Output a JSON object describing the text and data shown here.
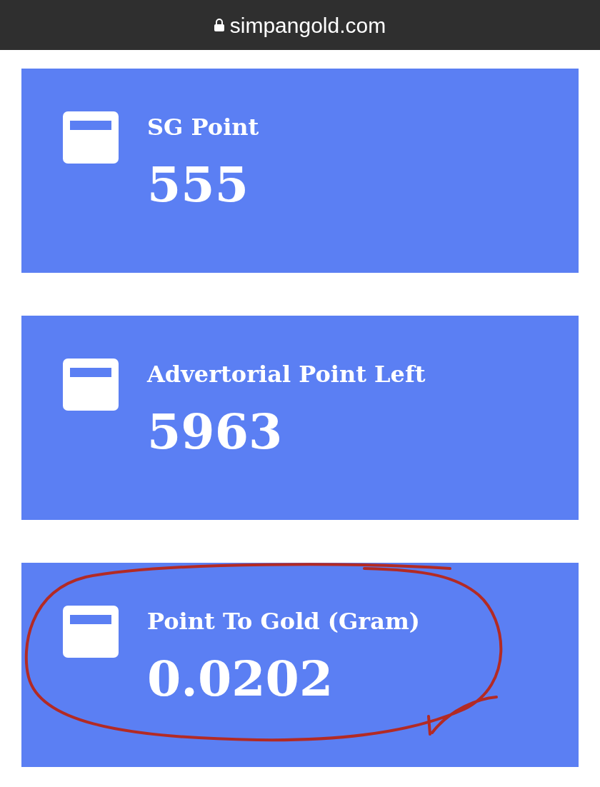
{
  "address_bar": {
    "url": "simpangold.com"
  },
  "cards": [
    {
      "title": "SG Point",
      "value": "555",
      "circled": false
    },
    {
      "title": "Advertorial Point Left",
      "value": "5963",
      "circled": false
    },
    {
      "title": "Point To Gold (Gram)",
      "value": "0.0202",
      "circled": true
    }
  ]
}
